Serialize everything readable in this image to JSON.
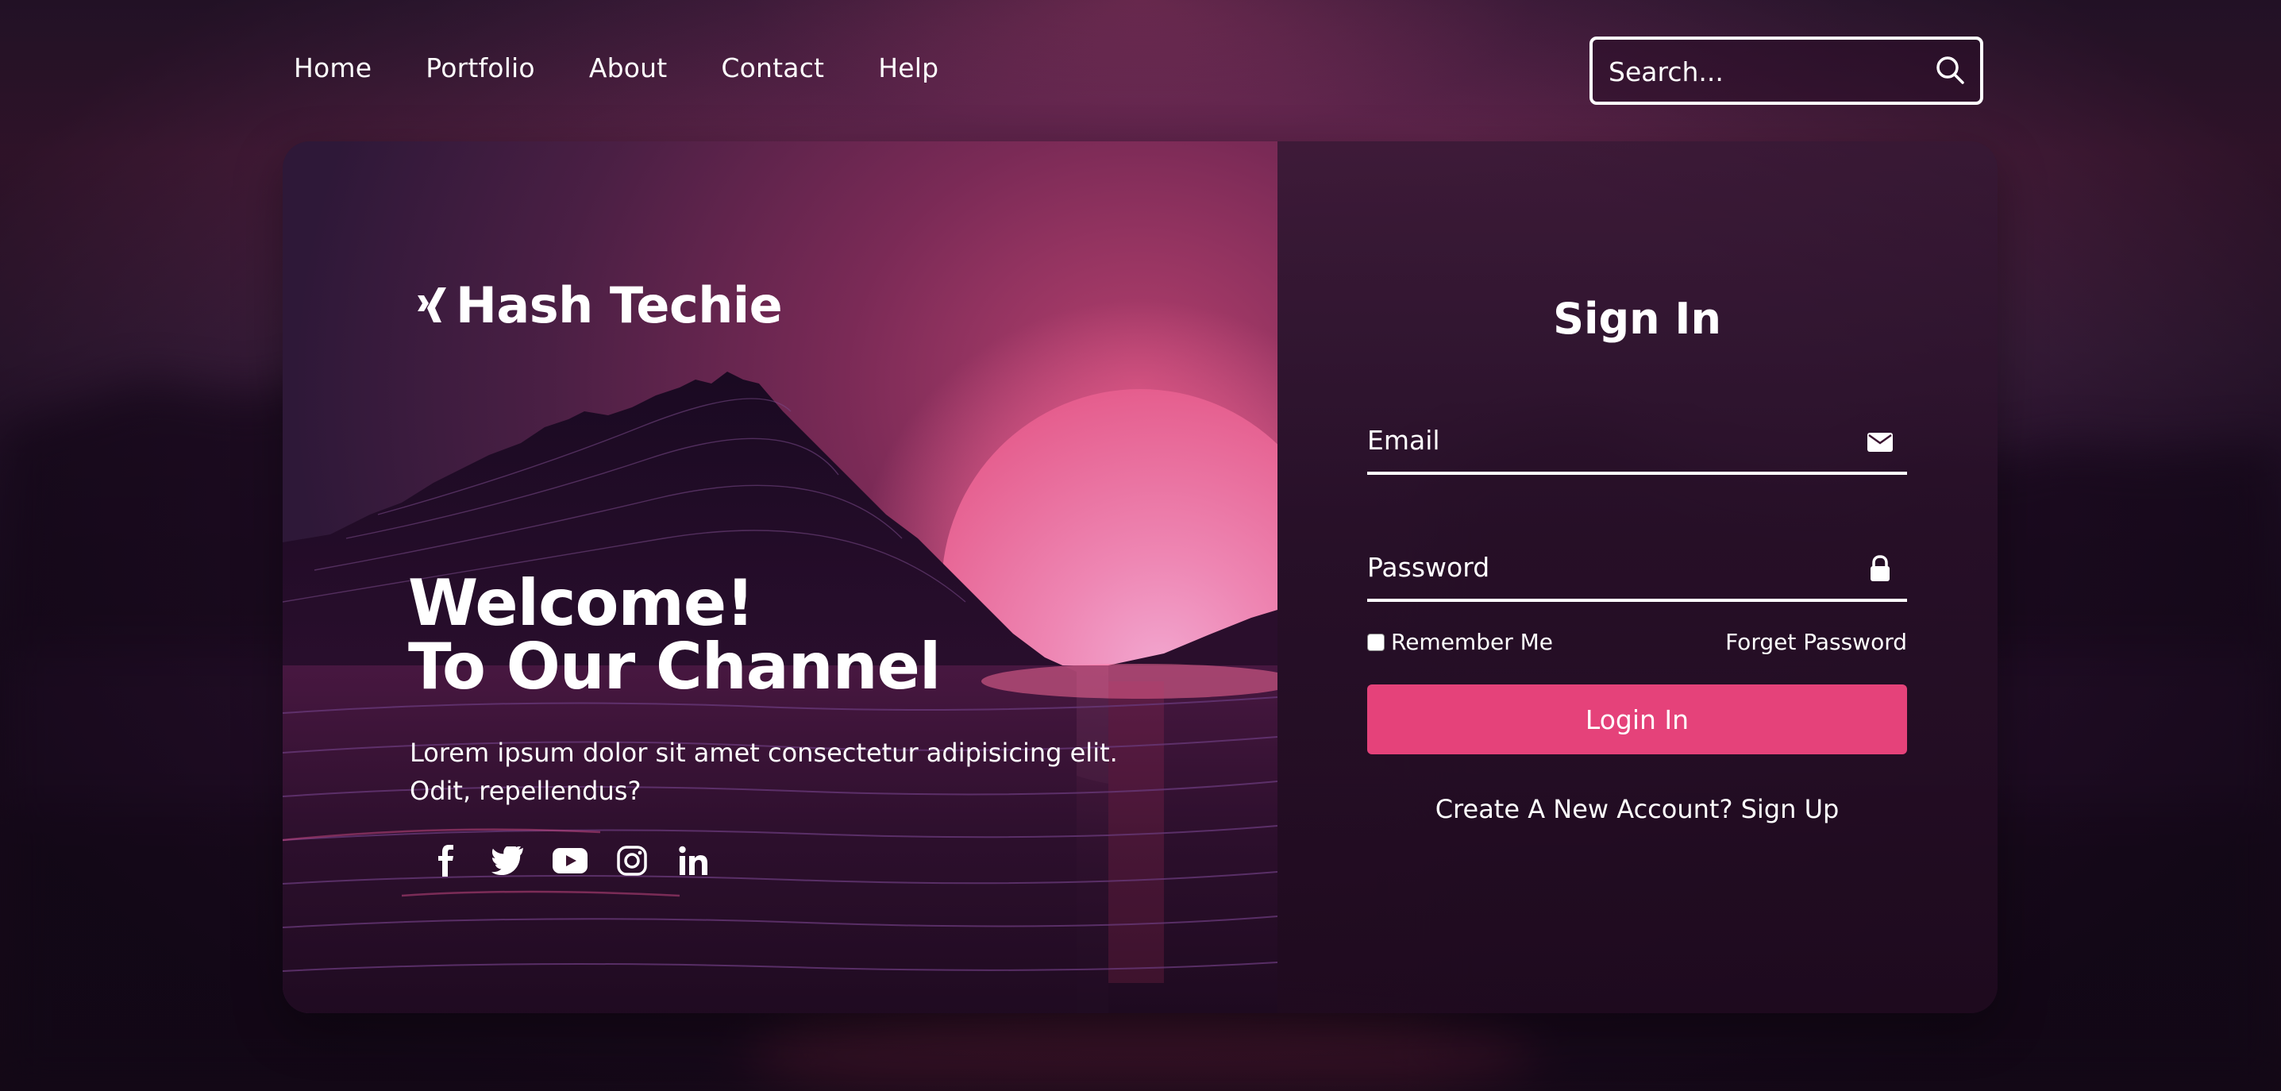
{
  "nav": {
    "items": [
      {
        "label": "Home"
      },
      {
        "label": "Portfolio"
      },
      {
        "label": "About"
      },
      {
        "label": "Contact"
      },
      {
        "label": "Help"
      }
    ]
  },
  "search": {
    "placeholder": "Search...",
    "icon": "search-icon"
  },
  "brand": {
    "name": "Hash Techie",
    "icon": "xing-logo"
  },
  "hero": {
    "headline_line1": "Welcome!",
    "headline_line2": "To Our Channel",
    "description": "Lorem ipsum dolor sit amet consectetur adipisicing elit. Odit, repellendus?",
    "social": [
      "facebook-icon",
      "twitter-icon",
      "youtube-icon",
      "instagram-icon",
      "linkedin-icon"
    ]
  },
  "signin": {
    "title": "Sign In",
    "email_placeholder": "Email",
    "email_icon": "envelope-icon",
    "password_placeholder": "Password",
    "password_icon": "lock-icon",
    "remember_label": "Remember Me",
    "remember_checked": false,
    "forgot_label": "Forget Password",
    "login_label": "Login In",
    "signup_label": "Create A New Account? Sign Up"
  },
  "colors": {
    "accent": "#e5427a",
    "text": "#ffffff",
    "background": "#2a1330"
  }
}
